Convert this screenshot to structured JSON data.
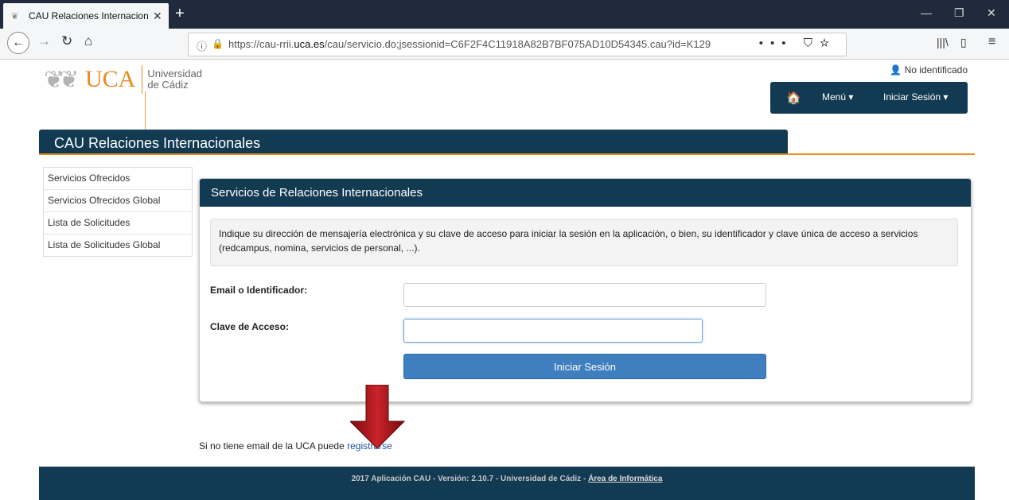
{
  "browser": {
    "tab_title": "CAU Relaciones Internacionales",
    "tab_favicon": "uca-logo-icon",
    "url_prefix": "https://cau-rrii.",
    "url_domain": "uca.es",
    "url_suffix": "/cau/servicio.do;jsessionid=C6F2F4C11918A82B7BF075AD10D54345.cau?id=K129"
  },
  "header": {
    "logo_text": "UCA",
    "univ_line1": "Universidad",
    "univ_line2": "de Cádiz",
    "user_status": "No identificado",
    "nav_menu": "Menú",
    "nav_login": "Iniciar Sesión",
    "banner_title": "CAU Relaciones Internacionales"
  },
  "sidebar": {
    "items": [
      {
        "label": "Servicios Ofrecidos"
      },
      {
        "label": "Servicios Ofrecidos Global"
      },
      {
        "label": "Lista de Solicitudes"
      },
      {
        "label": "Lista de Solicitudes Global"
      }
    ]
  },
  "panel": {
    "title": "Servicios de Relaciones Internacionales",
    "notice": "Indique su dirección de mensajería electrónica y su clave de acceso para iniciar la sesión en la aplicación, o bien, su identificador y clave única de acceso a servicios (redcampus, nomina, servicios de personal, ...).",
    "email_label": "Email o Identificador:",
    "email_value": "",
    "password_label": "Clave de Acceso:",
    "password_value": "",
    "submit_label": "Iniciar Sesión"
  },
  "register": {
    "text": "Si no tiene email de la UCA puede ",
    "link": "registrarse"
  },
  "footer": {
    "text": "2017 Aplicación CAU - Versión: 2.10.7 - Universidad de Cádiz - ",
    "link": "Área de Informática"
  },
  "colors": {
    "brand_dark": "#123a52",
    "brand_orange": "#e98b1e",
    "button_blue": "#3f7fbf",
    "annotation_arrow": "#b0191e"
  }
}
